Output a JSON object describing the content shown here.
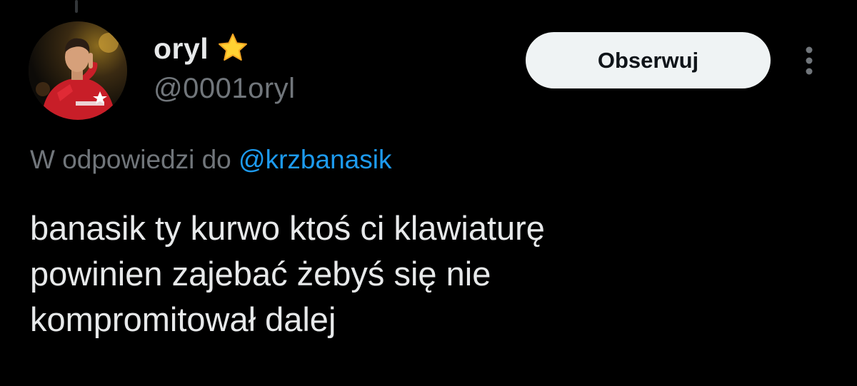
{
  "author": {
    "display_name": "oryl",
    "handle": "@0001oryl",
    "badge_icon": "star-icon",
    "avatar_icon": "avatar-image"
  },
  "actions": {
    "follow_label": "Obserwuj",
    "more_icon": "more-vertical-icon"
  },
  "reply": {
    "prefix": "W odpowiedzi do",
    "mention": "@krzbanasik"
  },
  "tweet": {
    "lines": [
      "banasik ty kurwo ktoś ci klawiaturę",
      "powinien zajebać żebyś się nie",
      "kompromitował dalej"
    ]
  },
  "colors": {
    "background": "#000000",
    "text": "#e7e9ea",
    "secondary": "#71767b",
    "link": "#1d9bf0",
    "button_bg": "#eff3f4",
    "button_text": "#0f1419",
    "star": "#ffd233"
  }
}
